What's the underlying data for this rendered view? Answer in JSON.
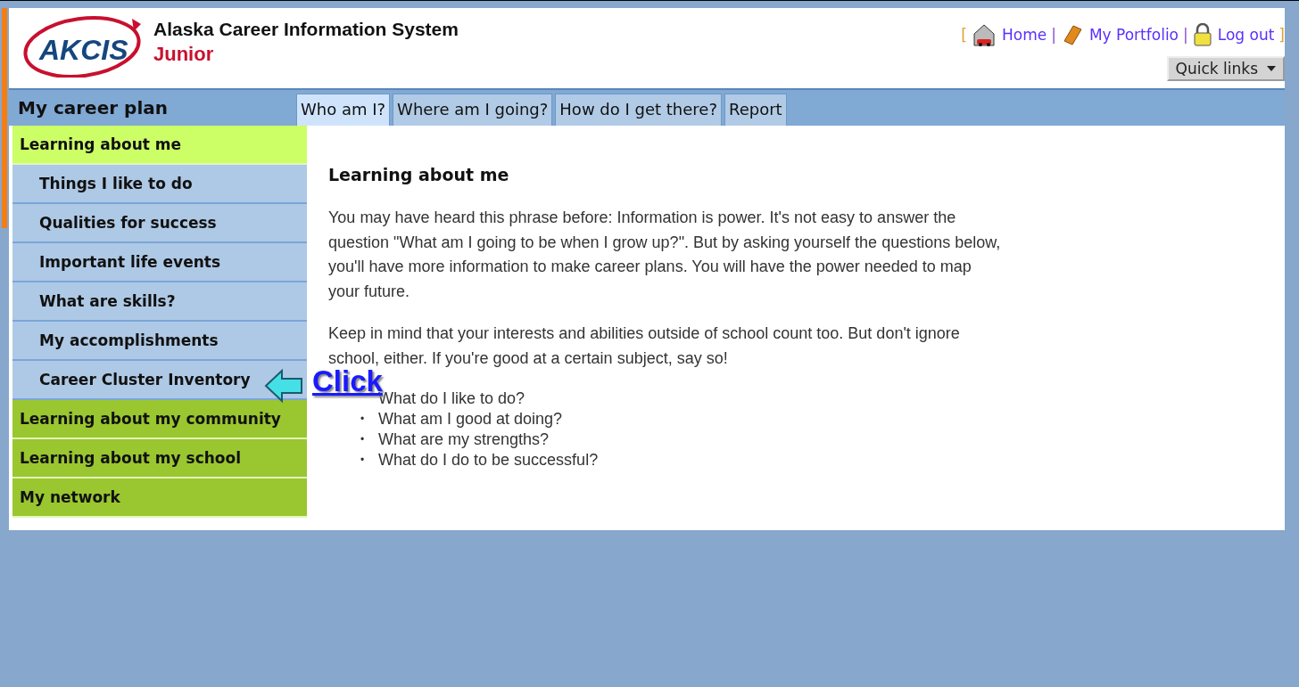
{
  "header": {
    "title": "Alaska Career Information System",
    "subtitle": "Junior",
    "logo_text": "AKCIS",
    "open_bracket": "[",
    "close_bracket": "]",
    "separators": [
      "|",
      "|"
    ],
    "links": [
      {
        "label": "Home"
      },
      {
        "label": "My Portfolio"
      },
      {
        "label": "Log out"
      }
    ],
    "quick_links": "Quick links"
  },
  "sidebar": {
    "title": "My career plan",
    "items": [
      {
        "label": "Learning about me",
        "selected": true,
        "children": [
          {
            "label": "Things I like to do"
          },
          {
            "label": "Qualities for success"
          },
          {
            "label": "Important life events"
          },
          {
            "label": "What are skills?"
          },
          {
            "label": "My accomplishments"
          },
          {
            "label": "Career Cluster Inventory"
          }
        ]
      },
      {
        "label": "Learning about my community",
        "selected": false
      },
      {
        "label": "Learning about my school",
        "selected": false
      },
      {
        "label": "My network",
        "selected": false
      }
    ]
  },
  "tabs": [
    {
      "label": "Who am I?",
      "selected": true
    },
    {
      "label": "Where am I going?",
      "selected": false
    },
    {
      "label": "How do I get there?",
      "selected": false
    },
    {
      "label": "Report",
      "selected": false
    }
  ],
  "content": {
    "heading": "Learning about me",
    "paragraphs": [
      "You may have heard this phrase before: Information is power. It's not easy to answer the question \"What am I going to be when I grow up?\". But by asking yourself the questions below, you'll have more information to make career plans. You will have the power needed to map your future.",
      "Keep in mind that your interests and abilities outside of school count too. But don't ignore school, either. If you're good at a certain subject, say so!"
    ],
    "questions": [
      {
        "text": "What do I like to do?"
      },
      {
        "bullet": "•",
        "text": "What am I good at doing?"
      },
      {
        "bullet": "•",
        "text": "What are my strengths?"
      },
      {
        "bullet": "•",
        "text": "What do I do to be successful?"
      }
    ]
  },
  "annotation": {
    "text": "Click"
  }
}
